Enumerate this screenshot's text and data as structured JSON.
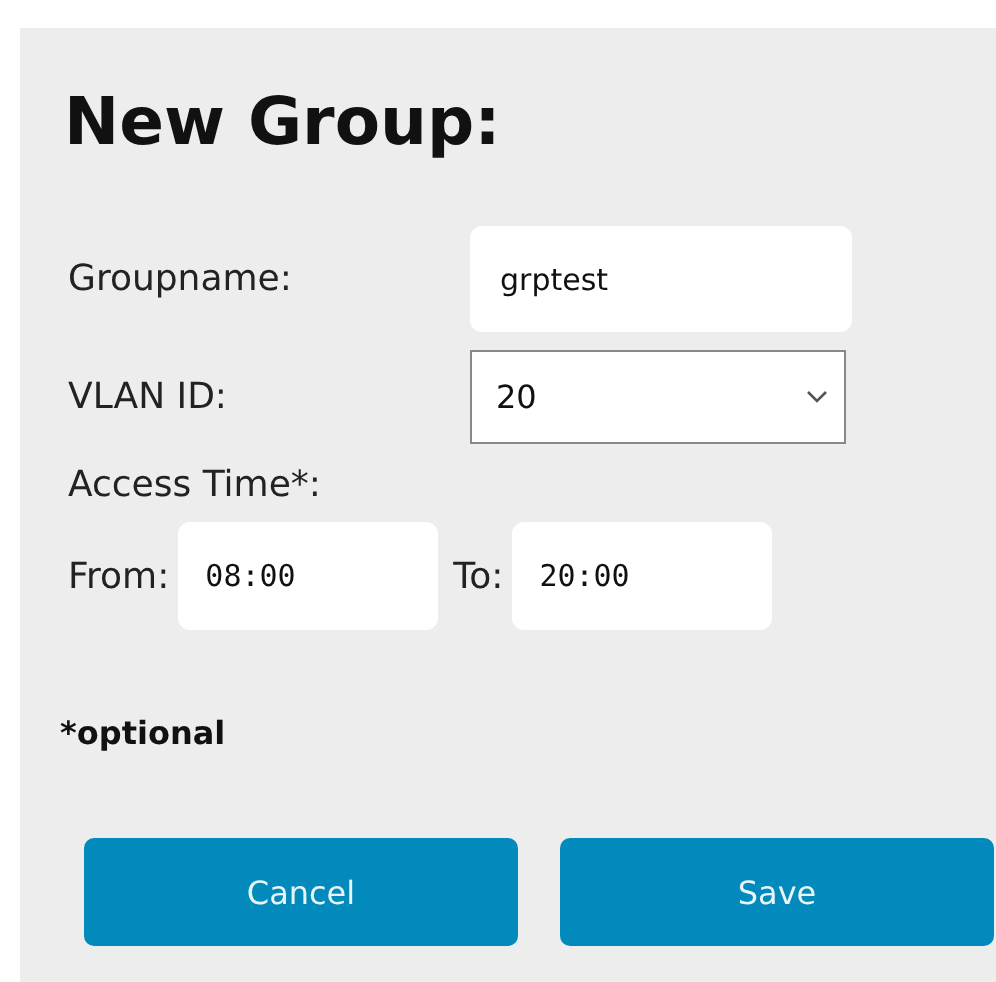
{
  "title": "New Group:",
  "fields": [
    {
      "label": "Groupname:",
      "kind": "text",
      "value": "grptest"
    },
    {
      "label": "VLAN ID:",
      "kind": "select",
      "value": "20"
    }
  ],
  "access_time": {
    "label": "Access Time*:",
    "from_label": "From:",
    "from_value": "08:00",
    "to_label": "To:",
    "to_value": "20:00"
  },
  "note": "*optional",
  "buttons": [
    "Cancel",
    "Save"
  ]
}
